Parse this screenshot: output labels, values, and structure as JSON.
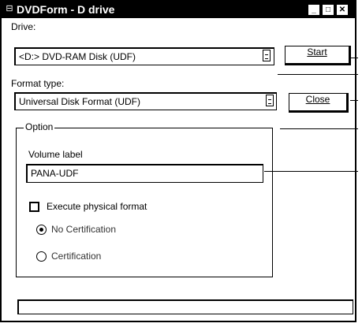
{
  "window": {
    "title": "DVDForm - D drive",
    "system_menu_glyph": "⊟",
    "controls": {
      "minimize": "_",
      "maximize": "□",
      "close": "✕"
    }
  },
  "drive": {
    "label": "Drive:",
    "selected": "<D:> DVD-RAM Disk (UDF)"
  },
  "format_type": {
    "label": "Format type:",
    "selected": "Universal Disk Format (UDF)"
  },
  "buttons": {
    "start": "Start",
    "close": "Close"
  },
  "option": {
    "legend": "Option",
    "volume_label": "Volume label",
    "volume_value": "PANA-UDF",
    "execute_physical_format": "Execute physical format",
    "certification_options": {
      "no_certification": "No Certification",
      "certification": "Certification",
      "selected": "No Certification"
    }
  }
}
